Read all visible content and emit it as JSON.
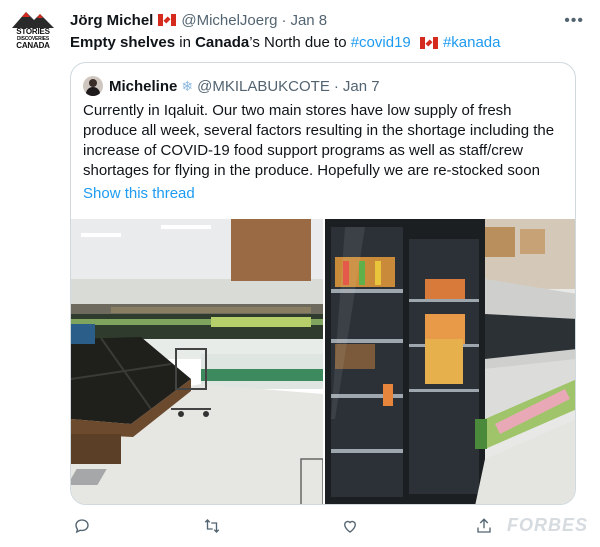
{
  "tweet": {
    "avatar_text": {
      "line1": "STORIES",
      "line2": "DISCOVERIES",
      "line3": "CANADA"
    },
    "author_name": "Jörg Michel",
    "author_handle": "@MichelJoerg",
    "dot": "·",
    "date": "Jan 8",
    "more_icon": "more-horizontal-icon",
    "text": {
      "part1": "Empty shelves",
      "part2": " in ",
      "part3": "Canada",
      "part4": "’s North due to ",
      "hashtag1": "#covid19",
      "hashtag2": "#kanada"
    }
  },
  "quoted": {
    "author_name": "Micheline",
    "snow_icon": "❄️",
    "author_handle": "@MKILABUKCOTE",
    "date": "Jan 7",
    "text": "Currently in Iqaluit. Our two main stores have low supply of fresh produce all week, several factors resulting in the shortage including the increase of COVID-19 food support programs as well as staff/crew shortages for flying in the produce. Hopefully we are re-stocked soon",
    "show_thread": "Show this thread"
  },
  "actions": [
    "reply-icon",
    "retweet-icon",
    "like-icon",
    "share-icon"
  ],
  "watermark": "FORBES",
  "colors": {
    "link": "#1d9bf0",
    "secondary": "#536471",
    "border": "#cfd9de",
    "flag_red": "#d52b1e"
  }
}
